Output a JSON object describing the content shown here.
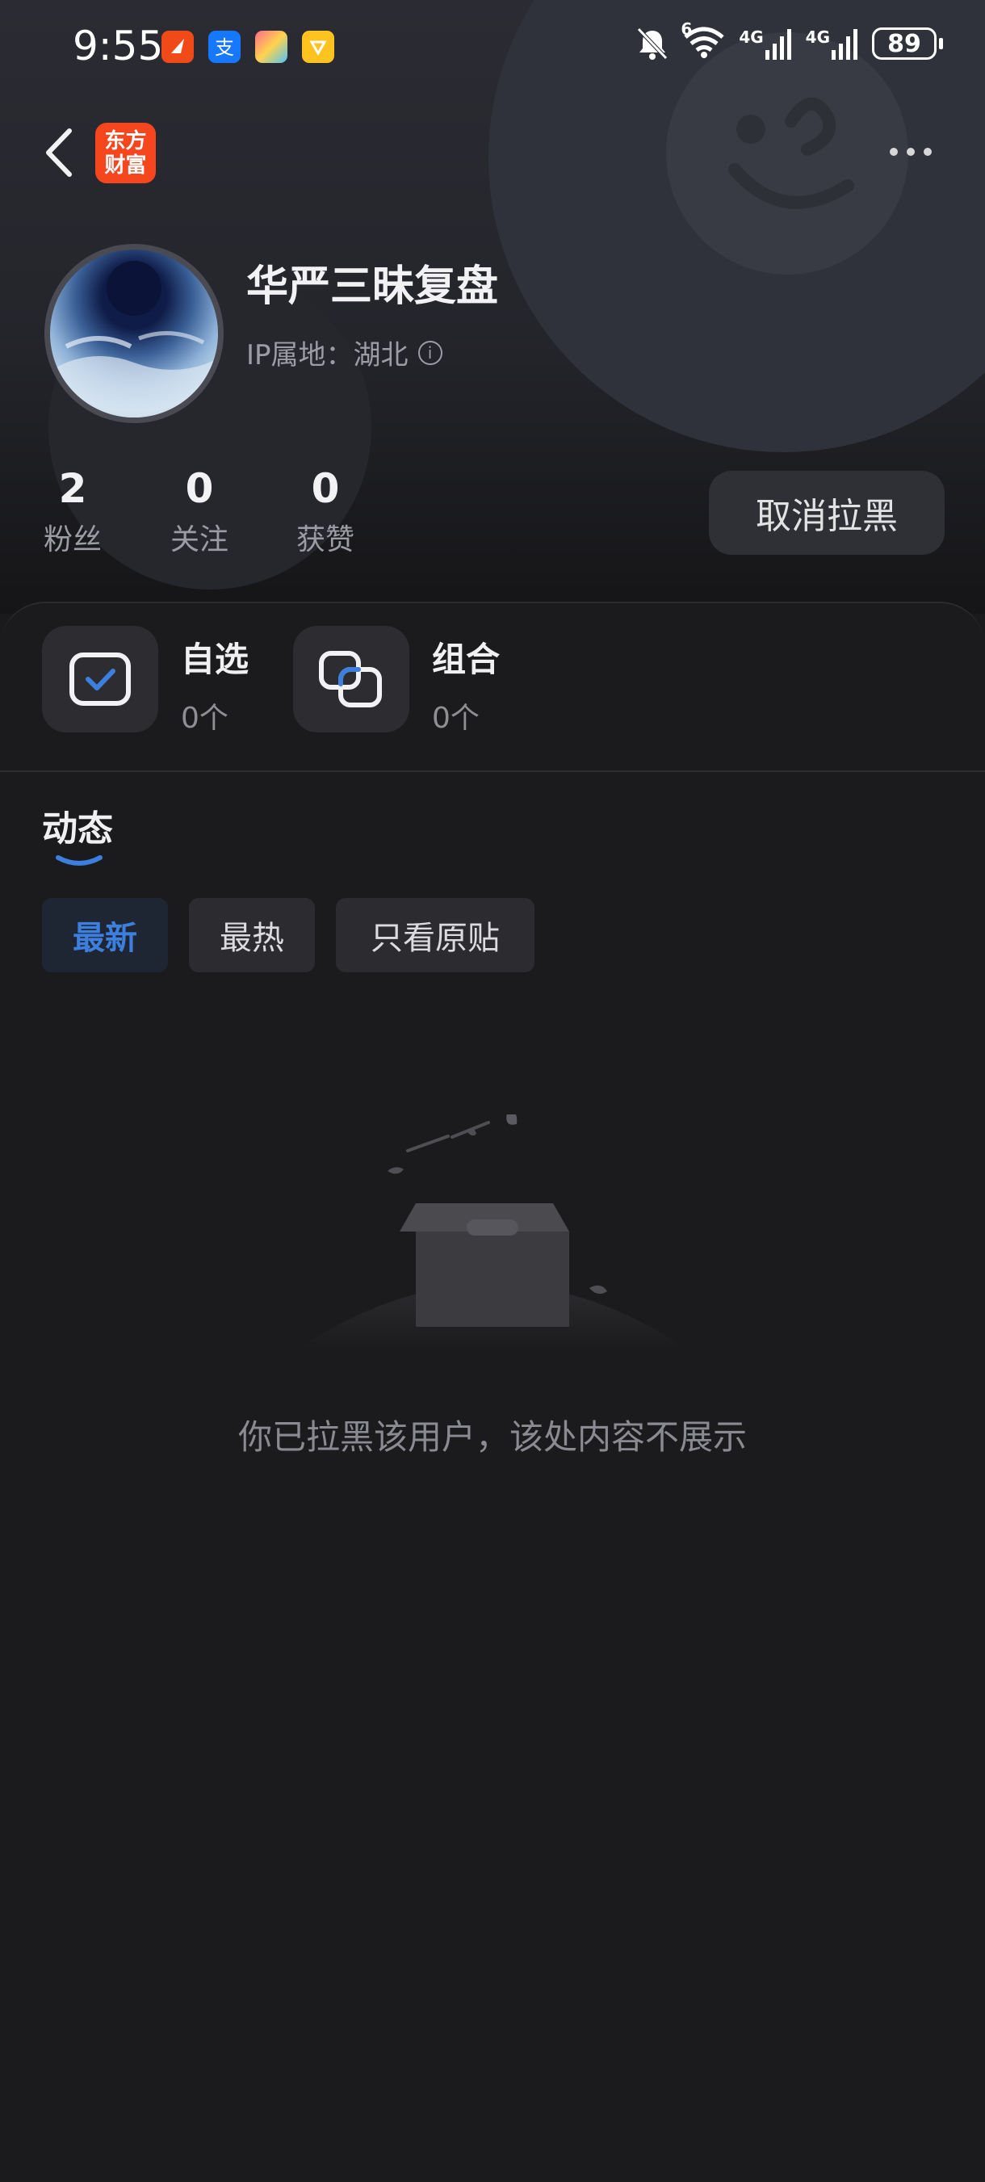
{
  "status_bar": {
    "time": "9:55",
    "signal_1": "4G",
    "signal_2": "4G",
    "wifi_badge": "6",
    "battery": "89",
    "app_icons": [
      "red-app-icon",
      "alipay-icon",
      "colorful-app-icon",
      "yellow-app-icon"
    ]
  },
  "nav": {
    "logo_line1": "东方",
    "logo_line2": "财富"
  },
  "profile": {
    "name": "华严三昧复盘",
    "ip_location": "IP属地：湖北",
    "stats": [
      {
        "value": "2",
        "label": "粉丝"
      },
      {
        "value": "0",
        "label": "关注"
      },
      {
        "value": "0",
        "label": "获赞"
      }
    ],
    "unblock_label": "取消拉黑"
  },
  "quick": [
    {
      "title": "自选",
      "count": "0个"
    },
    {
      "title": "组合",
      "count": "0个"
    }
  ],
  "feed": {
    "title": "动态",
    "filters": [
      "最新",
      "最热",
      "只看原贴"
    ],
    "active_filter": "最新",
    "empty_message": "你已拉黑该用户，该处内容不展示"
  },
  "colors": {
    "accent": "#3d7fde",
    "brand": "#f5461e",
    "background": "#1a1a1c"
  }
}
